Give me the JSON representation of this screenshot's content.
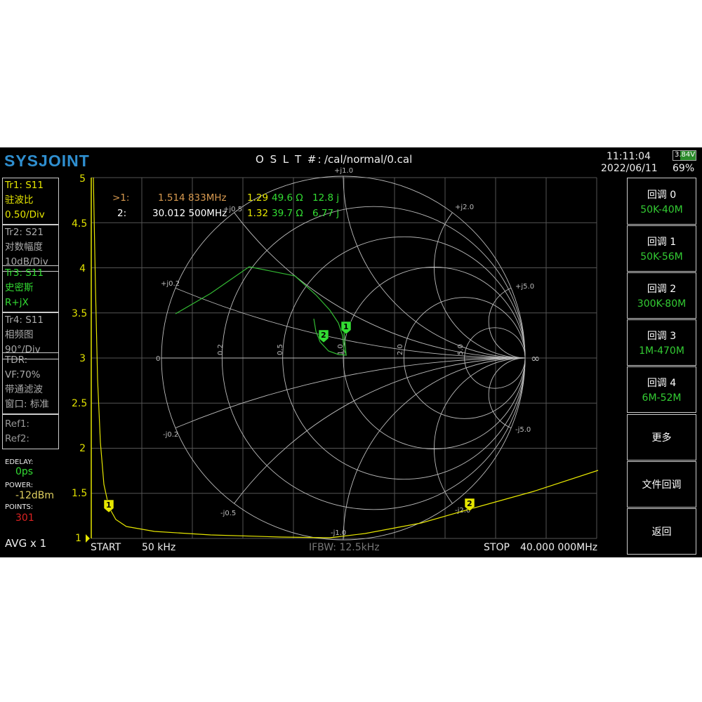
{
  "header": {
    "logo": "SYSJOINT",
    "cal_label": "O S L T #:",
    "cal_path": "/cal/normal/0.cal",
    "time": "11:11:04",
    "date": "2022/06/11",
    "battery_voltage": "3.84V",
    "battery_percent": "69%"
  },
  "traces": [
    {
      "line1": "Tr1:   S11",
      "line2": "驻波比",
      "line3": "0.50/Div",
      "color": "#e6e600"
    },
    {
      "line1": "Tr2:   S21",
      "line2": "对数幅度",
      "line3": "10dB/Div",
      "color": "#aaaaaa"
    },
    {
      "line1": "Tr3:   S11",
      "line2": "史密斯",
      "line3": "R+jX",
      "color": "#33dd33"
    },
    {
      "line1": "Tr4:   S11",
      "line2": "相频图",
      "line3": "90°/Div",
      "color": "#aaaaaa"
    }
  ],
  "tdr": {
    "line1": "TDR:",
    "line2": "VF:70%",
    "line3": "带通滤波",
    "line4": "窗口: 标准"
  },
  "refs": {
    "ref1": "Ref1:",
    "ref2": "Ref2:"
  },
  "status": {
    "edelay_label": "EDELAY:",
    "edelay": "0ps",
    "power_label": "POWER:",
    "power": "-12dBm",
    "points_label": "POINTS:",
    "points": "301",
    "avg": "AVG x 1"
  },
  "y_axis": [
    "5",
    "4.5",
    "4",
    "3.5",
    "3",
    "2.5",
    "2",
    "1.5",
    "1"
  ],
  "markers": [
    {
      "id": ">1:",
      "freq": "1.514 833MHz",
      "swr": "1.29",
      "r": "49.6 Ω",
      "x": "12.8 j"
    },
    {
      "id": "2:",
      "freq": "30.012 500MHz",
      "swr": "1.32",
      "r": "39.7 Ω",
      "x": "6.77 j"
    }
  ],
  "marker_flags": {
    "m1": "1",
    "m2": "2"
  },
  "smith_labels": {
    "top": "+j1.0",
    "bottom": "-j1.0",
    "p02": "+j0.2",
    "m02": "-j0.2",
    "p05": "+j0.5",
    "m05": "-j0.5",
    "p2": "+j2.0",
    "m2": "-j2.0",
    "p5": "+j5.0",
    "m5": "-j5.0",
    "r0": "0",
    "r02": "0.2",
    "r05": "0.5",
    "r1": "1.0",
    "r2": "2.0",
    "r5": "5.0",
    "inf": "∞"
  },
  "footer": {
    "start_label": "START",
    "start": "50 kHz",
    "ifbw": "IFBW: 12.5kHz",
    "stop_label": "STOP",
    "stop": "40.000 000MHz"
  },
  "buttons": [
    {
      "label": "回调 0",
      "sub": "50K-40M"
    },
    {
      "label": "回调 1",
      "sub": "50K-56M"
    },
    {
      "label": "回调 2",
      "sub": "300K-80M"
    },
    {
      "label": "回调 3",
      "sub": "1M-470M"
    },
    {
      "label": "回调 4",
      "sub": "6M-52M"
    },
    {
      "label": "更多"
    },
    {
      "label": "文件回调"
    },
    {
      "label": "返回"
    }
  ]
}
